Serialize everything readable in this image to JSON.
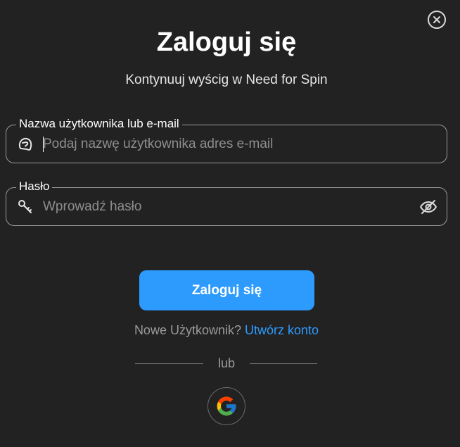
{
  "dialog": {
    "title": "Zaloguj się",
    "subtitle": "Kontynuuj wyścig w Need for Spin"
  },
  "username_field": {
    "label": "Nazwa użytkownika lub e-mail",
    "placeholder": "Podaj nazwę użytkownika adres e-mail",
    "value": "",
    "icon": "helmet-icon"
  },
  "password_field": {
    "label": "Hasło",
    "placeholder": "Wprowadź hasło",
    "value": "",
    "icon": "key-icon",
    "toggle_icon": "eye-off-icon"
  },
  "login_button": {
    "label": "Zaloguj się"
  },
  "signup": {
    "prompt": "Nowe Użytkownik?",
    "link": "Utwórz konto"
  },
  "divider": {
    "text": "lub"
  },
  "social": {
    "google_icon": "google-icon"
  },
  "colors": {
    "background": "#222222",
    "accent": "#2d9bfd",
    "border": "#9a9a9a",
    "muted_text": "#9a9a9a"
  }
}
